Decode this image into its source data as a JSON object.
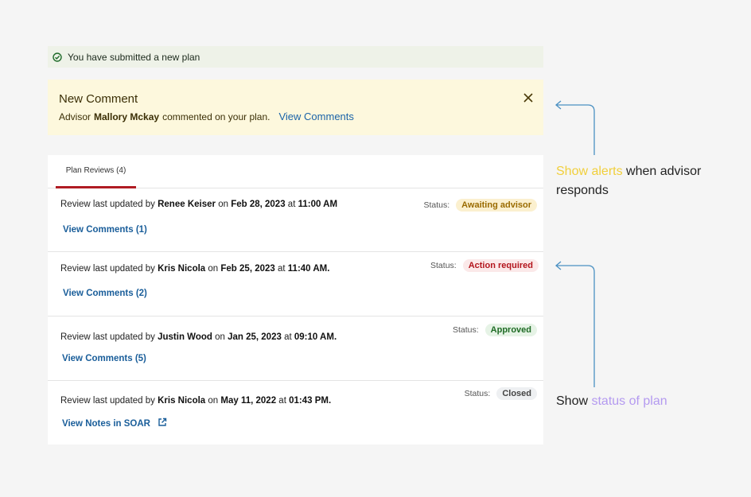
{
  "success_banner": {
    "text": "You have submitted a new plan"
  },
  "comment_alert": {
    "title": "New Comment",
    "prefix": "Advisor",
    "advisor_name": "Mallory Mckay",
    "suffix": "commented on your plan.",
    "link": "View Comments"
  },
  "tabs": [
    {
      "label": "Plan Reviews (4)"
    }
  ],
  "status_label": "Status:",
  "reviews": [
    {
      "intro": "Review last updated by",
      "name": "Renee Keiser",
      "on": "on",
      "date": "Feb 28, 2023",
      "at": "at",
      "time": "11:00 AM",
      "status": "Awaiting advisor",
      "status_bg": "#fbf0cf",
      "status_fg": "#9a6b00",
      "link": "View Comments (1)"
    },
    {
      "intro": "Review last updated by",
      "name": "Kris Nicola",
      "on": "on",
      "date": "Feb 25, 2023",
      "at": "at",
      "time": "11:40 AM.",
      "status": "Action required",
      "status_bg": "#fbe9e9",
      "status_fg": "#b3141c",
      "link": "View Comments (2)"
    },
    {
      "intro": "Review last updated by",
      "name": "Justin Wood",
      "on": "on",
      "date": "Jan 25, 2023",
      "at": "at",
      "time": "09:10 AM.",
      "status": "Approved",
      "status_bg": "#e6f3e6",
      "status_fg": "#1e6b24",
      "link": "View Comments (5)"
    },
    {
      "intro": "Review last updated by",
      "name": "Kris Nicola",
      "on": "on",
      "date": "May 11, 2022",
      "at": "at",
      "time": "01:43 PM.",
      "status": "Closed",
      "status_bg": "#eef0f2",
      "status_fg": "#444",
      "link": "View Notes in SOAR"
    }
  ],
  "annotations": {
    "alerts": {
      "highlight": "Show alerts",
      "rest_line1": "when advisor",
      "line2": "responds",
      "highlight_color": "#f1cf3b"
    },
    "status": {
      "prefix": "Show",
      "highlight": "status of plan",
      "highlight_color": "#b49af0"
    },
    "line_color": "#4a90c2"
  }
}
